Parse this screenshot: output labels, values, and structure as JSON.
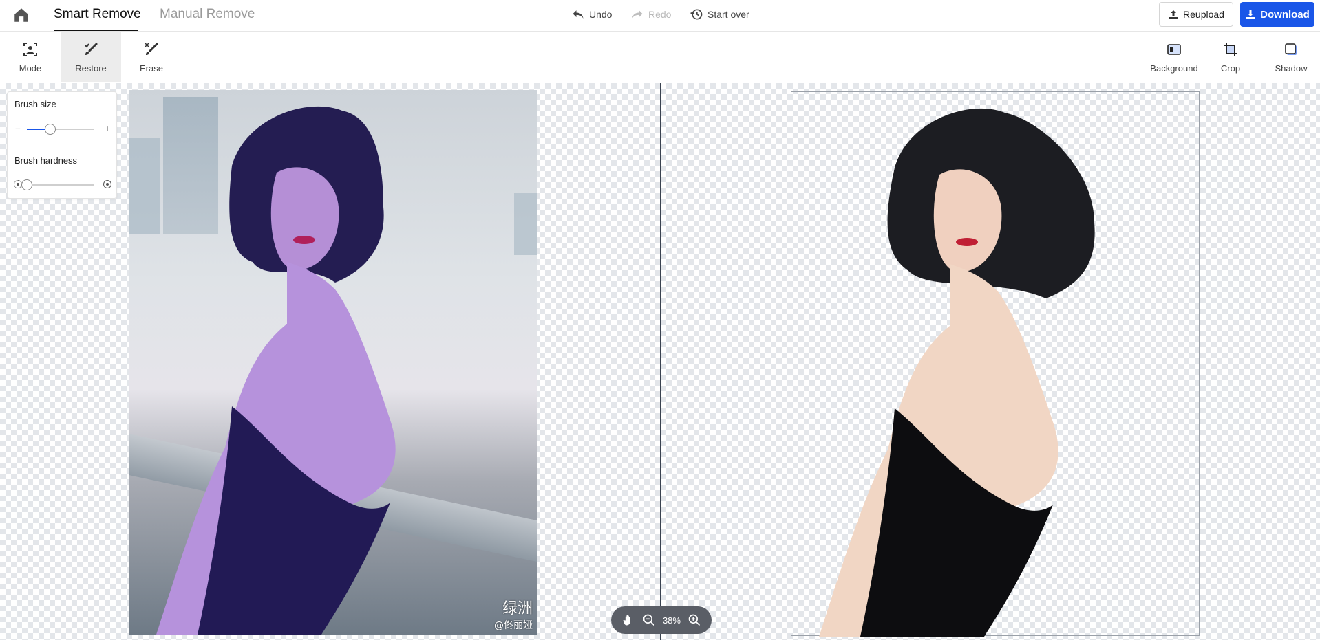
{
  "header": {
    "tabs": {
      "smart": "Smart Remove",
      "manual": "Manual Remove"
    },
    "history": {
      "undo": "Undo",
      "redo": "Redo",
      "start_over": "Start over"
    },
    "reupload": "Reupload",
    "download": "Download",
    "colors": {
      "accent": "#1a56e8",
      "disabled": "#b9b9b9"
    }
  },
  "toolbar": {
    "left_tools": [
      {
        "label": "Mode",
        "icon": "person-frame-icon"
      },
      {
        "label": "Restore",
        "icon": "restore-brush-icon",
        "active": true
      },
      {
        "label": "Erase",
        "icon": "erase-brush-icon"
      }
    ],
    "right_tools": [
      {
        "label": "Background",
        "icon": "background-icon"
      },
      {
        "label": "Crop",
        "icon": "crop-icon"
      },
      {
        "label": "Shadow",
        "icon": "shadow-icon"
      }
    ]
  },
  "brush_panel": {
    "size_label": "Brush size",
    "size_value": 0.35,
    "hardness_label": "Brush hardness",
    "hardness_value": 0,
    "minus": "−",
    "plus": "+"
  },
  "original_image": {
    "watermark_line1": "绿洲",
    "watermark_line2": "@佟丽娅"
  },
  "zoom": {
    "level": "38%"
  }
}
